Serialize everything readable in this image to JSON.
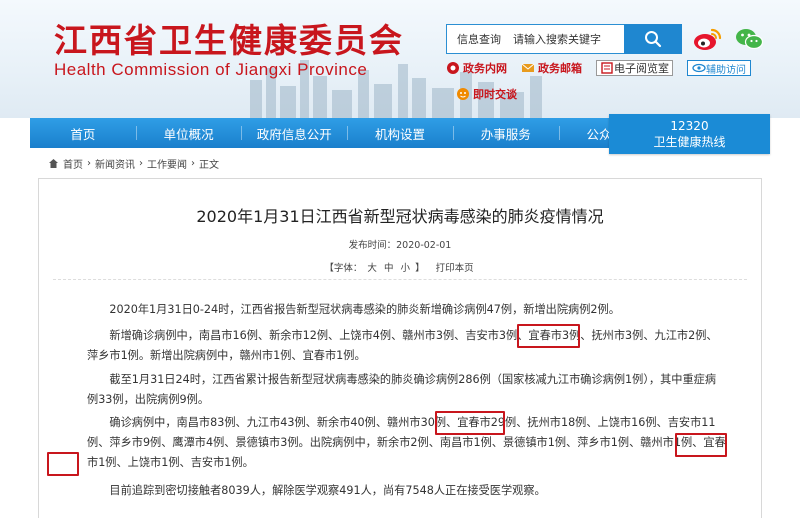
{
  "header": {
    "title_cn": "江西省卫生健康委员会",
    "title_en": "Health Commission of Jiangxi Province",
    "search": {
      "label": "信息查询",
      "placeholder": "请输入搜索关键字"
    },
    "quick_links": [
      "政务内网",
      "政务邮箱",
      "电子阅览室",
      "辅助访问"
    ],
    "realtime": "即时交谈"
  },
  "nav": {
    "items": [
      "首页",
      "单位概况",
      "政府信息公开",
      "机构设置",
      "办事服务",
      "公众参与"
    ],
    "hotline_number": "12320",
    "hotline_label": "卫生健康热线"
  },
  "breadcrumb": [
    "首页",
    "新闻资讯",
    "工作要闻",
    "正文"
  ],
  "article": {
    "title": "2020年1月31日江西省新型冠状病毒感染的肺炎疫情情况",
    "publish_label": "发布时间：",
    "publish_date": "2020-02-01",
    "font_label": "【字体：",
    "font_large": "大",
    "font_medium": "中",
    "font_small": "小",
    "font_close": "】",
    "print": "打印本页",
    "paragraphs": [
      "2020年1月31日0-24时，江西省报告新型冠状病毒感染的肺炎新增确诊病例47例，新增出院病例2例。",
      "新增确诊病例中，南昌市16例、新余市12例、上饶市4例、赣州市3例、吉安市3例、宜春市3例、抚州市3例、九江市2例、萍乡市1例。新增出院病例中，赣州市1例、宜春市1例。",
      "截至1月31日24时，江西省累计报告新型冠状病毒感染的肺炎确诊病例286例（国家核减九江市确诊病例1例），其中重症病例33例，出院病例9例。",
      "确诊病例中，南昌市83例、九江市43例、新余市40例、赣州市30例、宜春市29例、抚州市18例、上饶市16例、吉安市11例、萍乡市9例、鹰潭市4例、景德镇市3例。出院病例中，新余市2例、南昌市1例、景德镇市1例、萍乡市1例、赣州市1例、宜春市1例、上饶市1例、吉安市1例。",
      "目前追踪到密切接触者8039人，解除医学观察491人，尚有7548人正在接受医学观察。"
    ]
  },
  "colors": {
    "brand_red": "#c8161d",
    "nav_blue": "#1f87d0"
  }
}
